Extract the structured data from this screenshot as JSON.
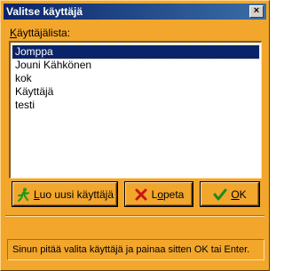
{
  "window": {
    "title": "Valitse käyttäjä",
    "close_glyph": "×"
  },
  "list": {
    "label_first": "K",
    "label_rest": "äyttäjälista:",
    "items": [
      "Jomppa",
      "Jouni Kähkönen",
      "kok",
      "Käyttäjä",
      "testi"
    ],
    "selected_index": 0
  },
  "buttons": {
    "new_user": {
      "mnemonic": "L",
      "rest": "uo uusi käyttäjä",
      "icon": "running-person-icon"
    },
    "quit": {
      "prefix": "L",
      "mnemonic": "o",
      "rest": "peta",
      "icon": "red-x-icon"
    },
    "ok": {
      "prefix": "",
      "mnemonic": "O",
      "rest": "K",
      "icon": "green-check-icon"
    }
  },
  "status": {
    "text": "Sinun pitää valita käyttäjä ja painaa sitten OK tai Enter."
  },
  "colors": {
    "background": "#f2a62c",
    "selection": "#0a246a",
    "titlebar": "#0a246a"
  }
}
